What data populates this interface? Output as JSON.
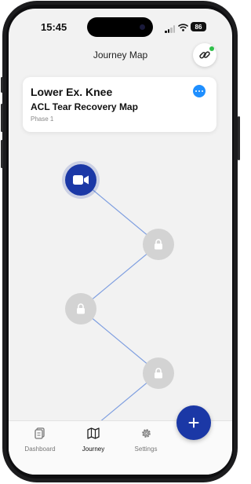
{
  "status_bar": {
    "time": "15:45",
    "battery": "86"
  },
  "header": {
    "title": "Journey Map"
  },
  "card": {
    "title": "Lower Ex. Knee",
    "subtitle": "ACL Tear Recovery Map",
    "phase": "Phase 1"
  },
  "map": {
    "nodes": [
      {
        "state": "active",
        "icon": "video-icon"
      },
      {
        "state": "locked",
        "icon": "lock-icon"
      },
      {
        "state": "locked",
        "icon": "lock-icon"
      },
      {
        "state": "locked",
        "icon": "lock-icon"
      },
      {
        "state": "locked",
        "icon": "lock-icon"
      }
    ]
  },
  "fab": {
    "icon": "plus-icon"
  },
  "tabbar": {
    "items": [
      {
        "label": "Dashboard",
        "icon": "clipboard-icon",
        "active": false
      },
      {
        "label": "Journey",
        "icon": "map-icon",
        "active": true
      },
      {
        "label": "Settings",
        "icon": "gear-icon",
        "active": false
      }
    ]
  },
  "colors": {
    "primary": "#1b38a6",
    "link_path": "#7f9fe0",
    "locked": "#d3d3d3",
    "online": "#2fbf4a",
    "more": "#1f8fff"
  }
}
